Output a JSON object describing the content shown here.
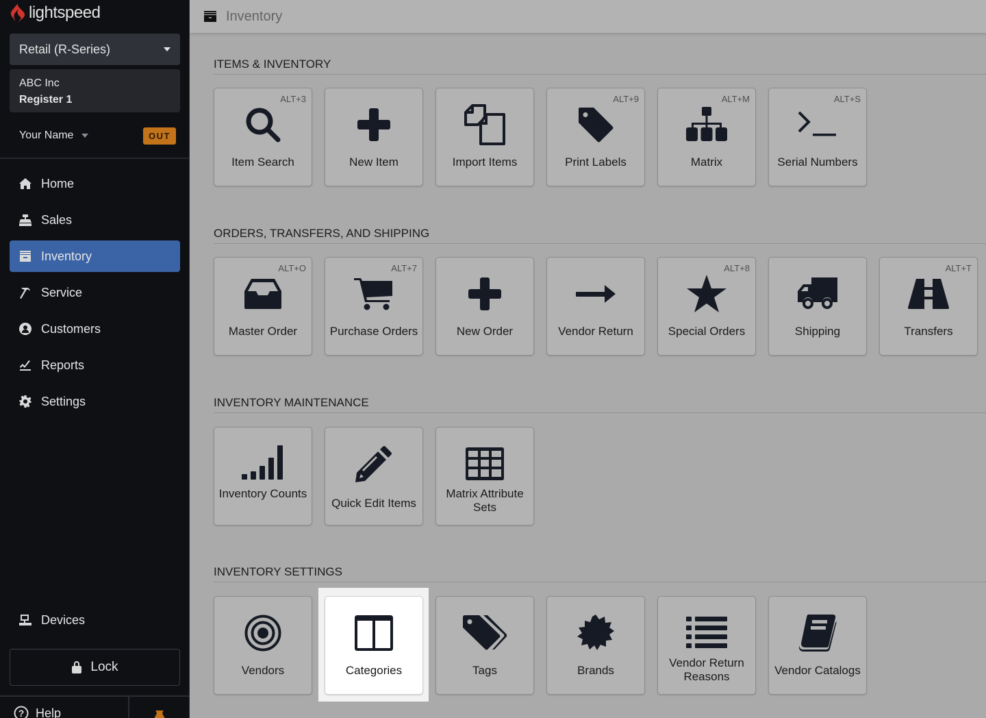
{
  "app": {
    "brand": "lightspeed",
    "brand_color": "#d0342c"
  },
  "sidebar": {
    "product_select": "Retail (R-Series)",
    "shop_name": "ABC Inc",
    "register": "Register 1",
    "user_name": "Your Name",
    "clock_status": "OUT",
    "nav": [
      {
        "label": "Home",
        "icon": "home-icon"
      },
      {
        "label": "Sales",
        "icon": "cash-register-icon"
      },
      {
        "label": "Inventory",
        "icon": "archive-icon",
        "active": true
      },
      {
        "label": "Service",
        "icon": "hammer-icon"
      },
      {
        "label": "Customers",
        "icon": "user-circle-icon"
      },
      {
        "label": "Reports",
        "icon": "chart-line-icon"
      },
      {
        "label": "Settings",
        "icon": "gear-icon"
      }
    ],
    "devices": "Devices",
    "lock": "Lock",
    "help": "Help"
  },
  "header": {
    "title": "Inventory",
    "icon": "archive-icon"
  },
  "sections": [
    {
      "title": "ITEMS & INVENTORY",
      "tiles": [
        {
          "label": "Item Search",
          "shortcut": "ALT+3",
          "icon": "search-icon"
        },
        {
          "label": "New Item",
          "shortcut": "",
          "icon": "plus-icon"
        },
        {
          "label": "Import Items",
          "shortcut": "",
          "icon": "copy-files-icon"
        },
        {
          "label": "Print Labels",
          "shortcut": "ALT+9",
          "icon": "tag-icon"
        },
        {
          "label": "Matrix",
          "shortcut": "ALT+M",
          "icon": "sitemap-icon"
        },
        {
          "label": "Serial Numbers",
          "shortcut": "ALT+S",
          "icon": "terminal-icon"
        }
      ]
    },
    {
      "title": "ORDERS, TRANSFERS, AND SHIPPING",
      "tiles": [
        {
          "label": "Master Order",
          "shortcut": "ALT+O",
          "icon": "inbox-icon"
        },
        {
          "label": "Purchase Orders",
          "shortcut": "ALT+7",
          "icon": "cart-icon"
        },
        {
          "label": "New Order",
          "shortcut": "",
          "icon": "plus-icon"
        },
        {
          "label": "Vendor Return",
          "shortcut": "",
          "icon": "arrow-right-icon"
        },
        {
          "label": "Special Orders",
          "shortcut": "ALT+8",
          "icon": "star-icon"
        },
        {
          "label": "Shipping",
          "shortcut": "",
          "icon": "truck-icon"
        },
        {
          "label": "Transfers",
          "shortcut": "ALT+T",
          "icon": "road-icon"
        }
      ]
    },
    {
      "title": "INVENTORY MAINTENANCE",
      "tiles": [
        {
          "label": "Inventory Counts",
          "shortcut": "",
          "icon": "signal-bars-icon"
        },
        {
          "label": "Quick Edit Items",
          "shortcut": "",
          "icon": "pencil-icon"
        },
        {
          "label": "Matrix Attribute Sets",
          "shortcut": "",
          "icon": "grid-table-icon"
        }
      ]
    },
    {
      "title": "INVENTORY SETTINGS",
      "tiles": [
        {
          "label": "Vendors",
          "shortcut": "",
          "icon": "bullseye-icon"
        },
        {
          "label": "Categories",
          "shortcut": "",
          "icon": "columns-icon",
          "highlighted": true
        },
        {
          "label": "Tags",
          "shortcut": "",
          "icon": "tags-icon"
        },
        {
          "label": "Brands",
          "shortcut": "",
          "icon": "certificate-icon"
        },
        {
          "label": "Vendor Return Reasons",
          "shortcut": "",
          "icon": "list-icon"
        },
        {
          "label": "Vendor Catalogs",
          "shortcut": "",
          "icon": "book-icon"
        }
      ]
    }
  ]
}
